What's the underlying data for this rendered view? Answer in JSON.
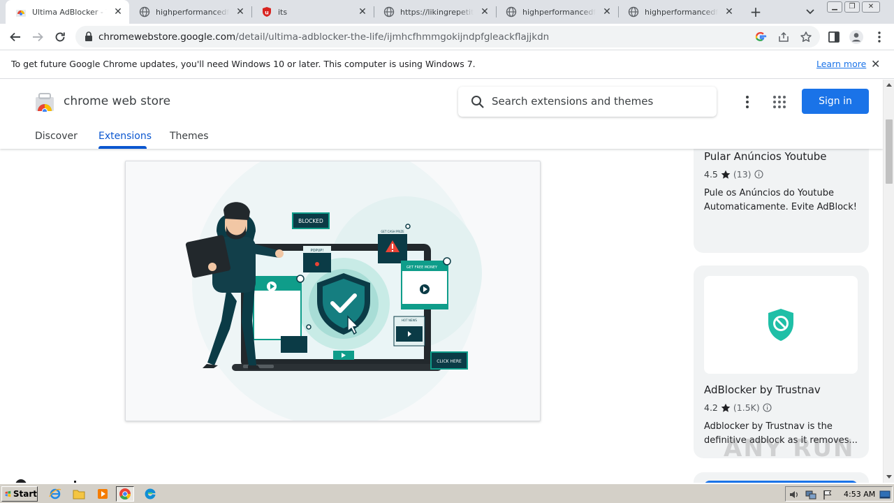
{
  "browser": {
    "tabs": [
      {
        "title": "Ultima AdBlocker - The l",
        "favicon": "chrome-web-store-icon",
        "active": true
      },
      {
        "title": "highperformancedformat",
        "favicon": "globe-icon",
        "active": false
      },
      {
        "title": "its",
        "favicon": "ublock-shield-icon",
        "active": false
      },
      {
        "title": "https://likingrepetitious",
        "favicon": "globe-icon",
        "active": false
      },
      {
        "title": "highperformancedformat",
        "favicon": "globe-icon",
        "active": false
      },
      {
        "title": "highperformancedformat",
        "favicon": "globe-icon",
        "active": false
      }
    ],
    "url_host": "chromewebstore.google.com",
    "url_path": "/detail/ultima-adblocker-the-life/ijmhcfhmmgokijndpfgleackflajjkdn",
    "infobar": {
      "message": "To get future Google Chrome updates, you'll need Windows 10 or later. This computer is using Windows 7.",
      "link": "Learn more"
    }
  },
  "store": {
    "name": "chrome web store",
    "search_placeholder": "Search extensions and themes",
    "sign_in": "Sign in",
    "nav": [
      "Discover",
      "Extensions",
      "Themes"
    ],
    "active_nav": "Extensions"
  },
  "hero": {
    "labels": {
      "blocked": "BLOCKED",
      "popup": "POPUP!",
      "get_free_money": "GET FREE MONEY",
      "click_here": "CLICK HERE",
      "get_cash_prize": "GET CASH PRIZE",
      "hot_news": "HOT NEWS"
    }
  },
  "related": [
    {
      "name": "Pular Anúncios Youtube",
      "rating": "4.5",
      "count": "(13)",
      "description": "Pule os Anúncios do Youtube Automaticamente. Evite AdBlock!"
    },
    {
      "name": "AdBlocker by Trustnav",
      "rating": "4.2",
      "count": "(1.5K)",
      "description": "Adblocker by Trustnav is the definitive adblock as it removes..."
    }
  ],
  "watermark": "ANY RUN",
  "taskbar": {
    "start": "Start",
    "clock": "4:53 AM"
  },
  "colors": {
    "accent_blue": "#1a73e8",
    "teal": "#0f9d8a",
    "dark_teal": "#0b3b46"
  }
}
